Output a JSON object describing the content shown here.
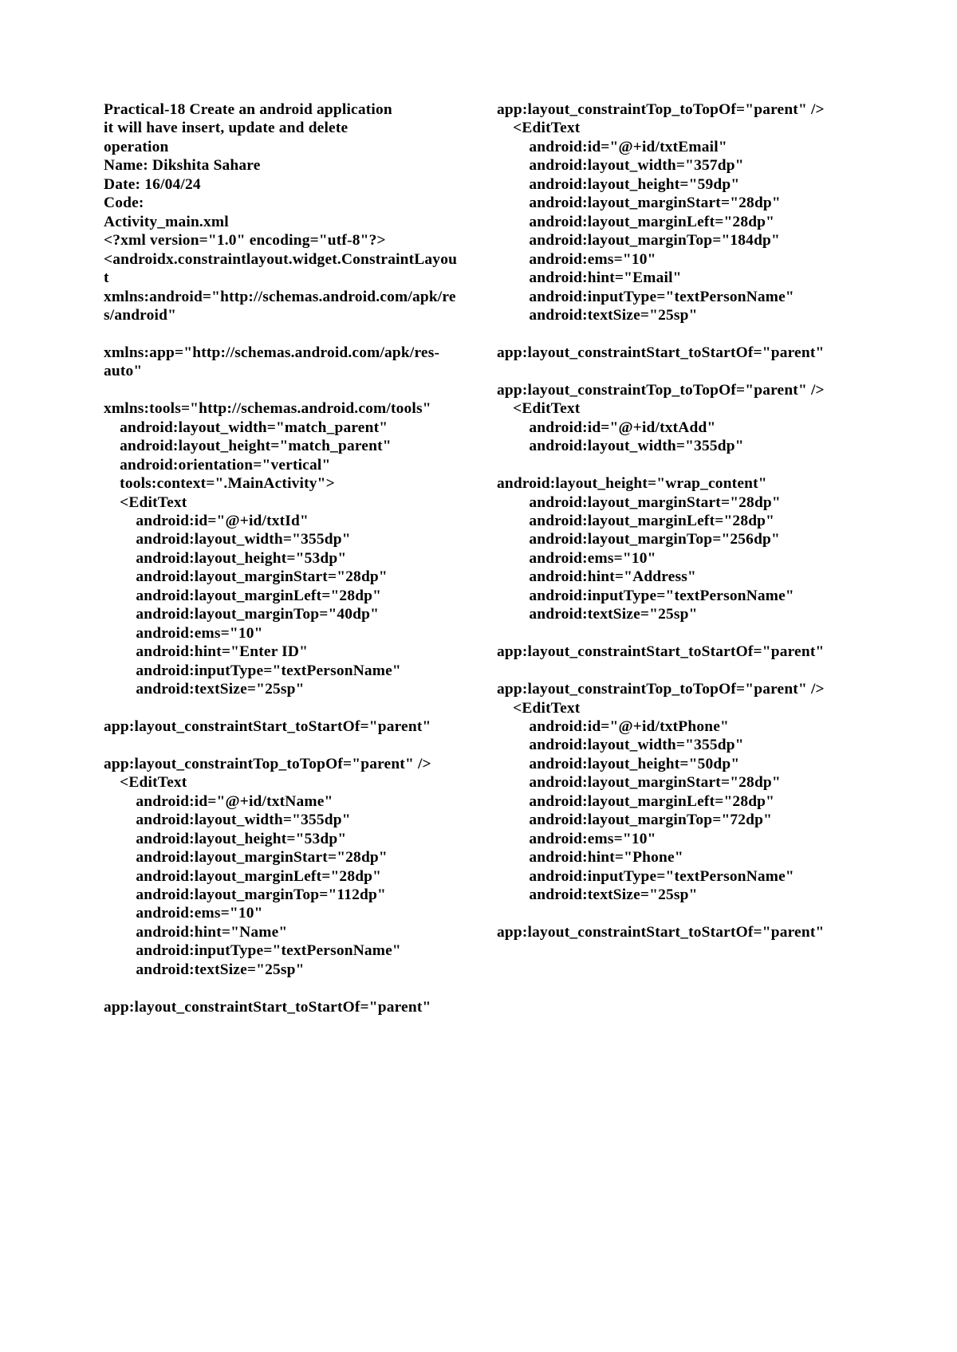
{
  "document": {
    "background_color": "#ffffff",
    "text_color": "#000000",
    "heading": {
      "practical_title": "Practical-18 Create an android application it will have insert, update and delete operation",
      "name_line": "Name: Dikshita Sahare",
      "date_line": "Date: 16/04/24",
      "code_label": "Code:",
      "file_name": "Activity_main.xml"
    },
    "left_column": {
      "lines": [
        "Practical-18 Create an android application",
        "it will have insert, update and delete",
        "operation",
        "Name: Dikshita Sahare",
        "Date: 16/04/24",
        "Code:",
        "Activity_main.xml",
        "<?xml version=\"1.0\" encoding=\"utf-8\"?>",
        "<androidx.constraintlayout.widget.ConstraintLayout",
        "xmlns:android=\"http://schemas.android.com/apk/res/android\"",
        "",
        "xmlns:app=\"http://schemas.android.com/apk/res-auto\"",
        "",
        "xmlns:tools=\"http://schemas.android.com/tools\"",
        "    android:layout_width=\"match_parent\"",
        "    android:layout_height=\"match_parent\"",
        "    android:orientation=\"vertical\"",
        "    tools:context=\".MainActivity\">",
        "    <EditText",
        "        android:id=\"@+id/txtId\"",
        "        android:layout_width=\"355dp\"",
        "        android:layout_height=\"53dp\"",
        "        android:layout_marginStart=\"28dp\"",
        "        android:layout_marginLeft=\"28dp\"",
        "        android:layout_marginTop=\"40dp\"",
        "        android:ems=\"10\"",
        "        android:hint=\"Enter ID\"",
        "        android:inputType=\"textPersonName\"",
        "        android:textSize=\"25sp\"",
        "",
        "app:layout_constraintStart_toStartOf=\"parent\"",
        "",
        "app:layout_constraintTop_toTopOf=\"parent\" />",
        "    <EditText",
        "        android:id=\"@+id/txtName\"",
        "        android:layout_width=\"355dp\"",
        "        android:layout_height=\"53dp\"",
        "        android:layout_marginStart=\"28dp\"",
        "        android:layout_marginLeft=\"28dp\"",
        "        android:layout_marginTop=\"112dp\"",
        "        android:ems=\"10\"",
        "        android:hint=\"Name\"",
        "        android:inputType=\"textPersonName\"",
        "        android:textSize=\"25sp\"",
        "",
        "app:layout_constraintStart_toStartOf=\"parent\""
      ]
    },
    "right_column": {
      "lines": [
        "app:layout_constraintTop_toTopOf=\"parent\" />",
        "    <EditText",
        "        android:id=\"@+id/txtEmail\"",
        "        android:layout_width=\"357dp\"",
        "        android:layout_height=\"59dp\"",
        "        android:layout_marginStart=\"28dp\"",
        "        android:layout_marginLeft=\"28dp\"",
        "        android:layout_marginTop=\"184dp\"",
        "        android:ems=\"10\"",
        "        android:hint=\"Email\"",
        "        android:inputType=\"textPersonName\"",
        "        android:textSize=\"25sp\"",
        "",
        "app:layout_constraintStart_toStartOf=\"parent\"",
        "",
        "app:layout_constraintTop_toTopOf=\"parent\" />",
        "    <EditText",
        "        android:id=\"@+id/txtAdd\"",
        "        android:layout_width=\"355dp\"",
        "",
        "android:layout_height=\"wrap_content\"",
        "        android:layout_marginStart=\"28dp\"",
        "        android:layout_marginLeft=\"28dp\"",
        "        android:layout_marginTop=\"256dp\"",
        "        android:ems=\"10\"",
        "        android:hint=\"Address\"",
        "        android:inputType=\"textPersonName\"",
        "        android:textSize=\"25sp\"",
        "",
        "app:layout_constraintStart_toStartOf=\"parent\"",
        "",
        "app:layout_constraintTop_toTopOf=\"parent\" />",
        "    <EditText",
        "        android:id=\"@+id/txtPhone\"",
        "        android:layout_width=\"355dp\"",
        "        android:layout_height=\"50dp\"",
        "        android:layout_marginStart=\"28dp\"",
        "        android:layout_marginLeft=\"28dp\"",
        "        android:layout_marginTop=\"72dp\"",
        "        android:ems=\"10\"",
        "        android:hint=\"Phone\"",
        "        android:inputType=\"textPersonName\"",
        "        android:textSize=\"25sp\"",
        "",
        "app:layout_constraintStart_toStartOf=\"parent\""
      ]
    }
  }
}
